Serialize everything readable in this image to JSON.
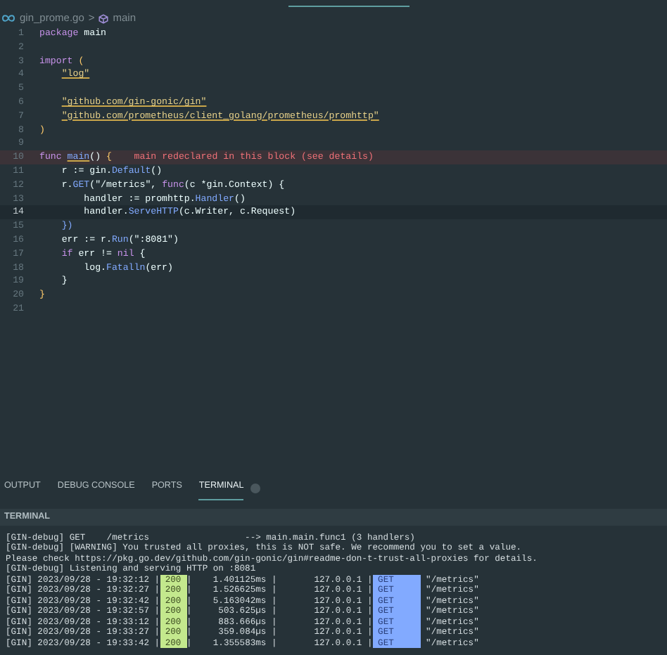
{
  "breadcrumb": {
    "file": "gin_prome.go",
    "separator": ">",
    "symbol": "main"
  },
  "code_lines": [
    {
      "number": "1",
      "current": false,
      "error": false,
      "tokens": [
        {
          "kind": "keyword",
          "text": "package"
        },
        {
          "kind": "plain",
          "text": " main"
        }
      ]
    },
    {
      "number": "2",
      "current": false,
      "error": false
    },
    {
      "number": "3",
      "current": false,
      "error": false,
      "tokens": [
        {
          "kind": "keyword",
          "text": "import"
        },
        {
          "kind": "bracket",
          "text": " ("
        }
      ]
    },
    {
      "number": "4",
      "current": false,
      "error": false,
      "tokens": [
        {
          "kind": "string",
          "text": "    \"log\""
        }
      ]
    },
    {
      "number": "5",
      "current": false,
      "error": false
    },
    {
      "number": "6",
      "current": false,
      "error": false,
      "tokens": [
        {
          "kind": "string",
          "text": "    \"github.com/gin-gonic/gin\""
        }
      ]
    },
    {
      "number": "7",
      "current": false,
      "error": false,
      "tokens": [
        {
          "kind": "string",
          "text": "    \"github.com/prometheus/client_golang/prometheus/promhttp\""
        }
      ]
    },
    {
      "number": "8",
      "current": false,
      "error": false,
      "tokens": [
        {
          "kind": "bracket",
          "text": ")"
        }
      ]
    },
    {
      "number": "9",
      "current": false,
      "error": false
    },
    {
      "number": "10",
      "current": false,
      "error": true,
      "tokens": [
        {
          "kind": "keyword",
          "text": "func"
        },
        {
          "kind": "func",
          "text": " main"
        },
        {
          "kind": "plain",
          "text": "() "
        },
        {
          "kind": "bracket",
          "text": "{"
        },
        {
          "kind": "error",
          "text": "    main redeclared in this block (see details)"
        }
      ]
    },
    {
      "number": "11",
      "current": false,
      "error": false,
      "tokens": [
        {
          "kind": "plain",
          "text": "    r := gin."
        },
        {
          "kind": "method",
          "text": "Default"
        },
        {
          "kind": "plain",
          "text": "()"
        }
      ]
    },
    {
      "number": "12",
      "current": false,
      "error": false,
      "tokens": [
        {
          "kind": "plain",
          "text": "    r."
        },
        {
          "kind": "method",
          "text": "GET"
        },
        {
          "kind": "plain",
          "text": "(\"/metrics\", "
        },
        {
          "kind": "keyword",
          "text": "func"
        },
        {
          "kind": "plain",
          "text": "(c *gin.Context) {"
        }
      ]
    },
    {
      "number": "13",
      "current": false,
      "error": false,
      "tokens": [
        {
          "kind": "plain",
          "text": "        handler := promhttp."
        },
        {
          "kind": "method",
          "text": "Handler"
        },
        {
          "kind": "plain",
          "text": "()"
        }
      ]
    },
    {
      "number": "14",
      "current": true,
      "error": false,
      "tokens": [
        {
          "kind": "plain",
          "text": "        handler."
        },
        {
          "kind": "method",
          "text": "ServeHTTP"
        },
        {
          "kind": "plain",
          "text": "(c.Writer, c.Request)"
        }
      ]
    },
    {
      "number": "15",
      "current": false,
      "error": false,
      "tokens": [
        {
          "kind": "method",
          "text": "    })"
        }
      ]
    },
    {
      "number": "16",
      "current": false,
      "error": false,
      "tokens": [
        {
          "kind": "plain",
          "text": "    err := r."
        },
        {
          "kind": "method",
          "text": "Run"
        },
        {
          "kind": "plain",
          "text": "(\":8081\")"
        }
      ]
    },
    {
      "number": "17",
      "current": false,
      "error": false,
      "tokens": [
        {
          "kind": "keyword",
          "text": "    if"
        },
        {
          "kind": "plain",
          "text": " err != "
        },
        {
          "kind": "keyword",
          "text": "nil"
        },
        {
          "kind": "plain",
          "text": " {"
        }
      ]
    },
    {
      "number": "18",
      "current": false,
      "error": false,
      "tokens": [
        {
          "kind": "plain",
          "text": "        log."
        },
        {
          "kind": "method",
          "text": "Fatalln"
        },
        {
          "kind": "plain",
          "text": "(err)"
        }
      ]
    },
    {
      "number": "19",
      "current": false,
      "error": false,
      "tokens": [
        {
          "kind": "plain",
          "text": "    }"
        }
      ]
    },
    {
      "number": "20",
      "current": false,
      "error": false,
      "tokens": [
        {
          "kind": "bracket",
          "text": "}"
        }
      ]
    },
    {
      "number": "21",
      "current": false,
      "error": false
    }
  ],
  "panel_tabs": [
    {
      "label": "OUTPUT",
      "selected": false
    },
    {
      "label": "DEBUG CONSOLE",
      "selected": false
    },
    {
      "label": "PORTS",
      "selected": false
    },
    {
      "label": "TERMINAL",
      "selected": true
    }
  ],
  "terminal": {
    "title": "TERMINAL",
    "lines": [
      [
        {
          "kind": "plain",
          "text": "[GIN-debug] GET    /metrics                  --> main.main.func1 (3 handlers)"
        }
      ],
      [
        {
          "kind": "plain",
          "text": "[GIN-debug] [WARNING] You trusted all proxies, this is NOT safe. We recommend you to set a value."
        }
      ],
      [
        {
          "kind": "plain",
          "text": "Please check https://pkg.go.dev/github.com/gin-gonic/gin#readme-don-t-trust-all-proxies for details."
        }
      ],
      [
        {
          "kind": "plain",
          "text": "[GIN-debug] Listening and serving HTTP on :8081"
        }
      ],
      [
        {
          "kind": "plain",
          "text": "[GIN] 2023/09/28 - 19:32:12 |"
        },
        {
          "kind": "status",
          "text": " 200 "
        },
        {
          "kind": "plain",
          "text": "|    1.401125ms |       127.0.0.1 |"
        },
        {
          "kind": "method",
          "text": " GET     "
        },
        {
          "kind": "plain",
          "text": " \"/metrics\""
        }
      ],
      [
        {
          "kind": "plain",
          "text": "[GIN] 2023/09/28 - 19:32:27 |"
        },
        {
          "kind": "status",
          "text": " 200 "
        },
        {
          "kind": "plain",
          "text": "|    1.526625ms |       127.0.0.1 |"
        },
        {
          "kind": "method",
          "text": " GET     "
        },
        {
          "kind": "plain",
          "text": " \"/metrics\""
        }
      ],
      [
        {
          "kind": "plain",
          "text": "[GIN] 2023/09/28 - 19:32:42 |"
        },
        {
          "kind": "status",
          "text": " 200 "
        },
        {
          "kind": "plain",
          "text": "|    5.163042ms |       127.0.0.1 |"
        },
        {
          "kind": "method",
          "text": " GET     "
        },
        {
          "kind": "plain",
          "text": " \"/metrics\""
        }
      ],
      [
        {
          "kind": "plain",
          "text": "[GIN] 2023/09/28 - 19:32:57 |"
        },
        {
          "kind": "status",
          "text": " 200 "
        },
        {
          "kind": "plain",
          "text": "|     503.625µs |       127.0.0.1 |"
        },
        {
          "kind": "method",
          "text": " GET     "
        },
        {
          "kind": "plain",
          "text": " \"/metrics\""
        }
      ],
      [
        {
          "kind": "plain",
          "text": "[GIN] 2023/09/28 - 19:33:12 |"
        },
        {
          "kind": "status",
          "text": " 200 "
        },
        {
          "kind": "plain",
          "text": "|     883.666µs |       127.0.0.1 |"
        },
        {
          "kind": "method",
          "text": " GET     "
        },
        {
          "kind": "plain",
          "text": " \"/metrics\""
        }
      ],
      [
        {
          "kind": "plain",
          "text": "[GIN] 2023/09/28 - 19:33:27 |"
        },
        {
          "kind": "status",
          "text": " 200 "
        },
        {
          "kind": "plain",
          "text": "|     359.084µs |       127.0.0.1 |"
        },
        {
          "kind": "method",
          "text": " GET     "
        },
        {
          "kind": "plain",
          "text": " \"/metrics\""
        }
      ],
      [
        {
          "kind": "plain",
          "text": "[GIN] 2023/09/28 - 19:33:42 |"
        },
        {
          "kind": "status",
          "text": " 200 "
        },
        {
          "kind": "plain",
          "text": "|    1.355583ms |       127.0.0.1 |"
        },
        {
          "kind": "method",
          "text": " GET     "
        },
        {
          "kind": "plain",
          "text": " \"/metrics\""
        }
      ]
    ]
  }
}
